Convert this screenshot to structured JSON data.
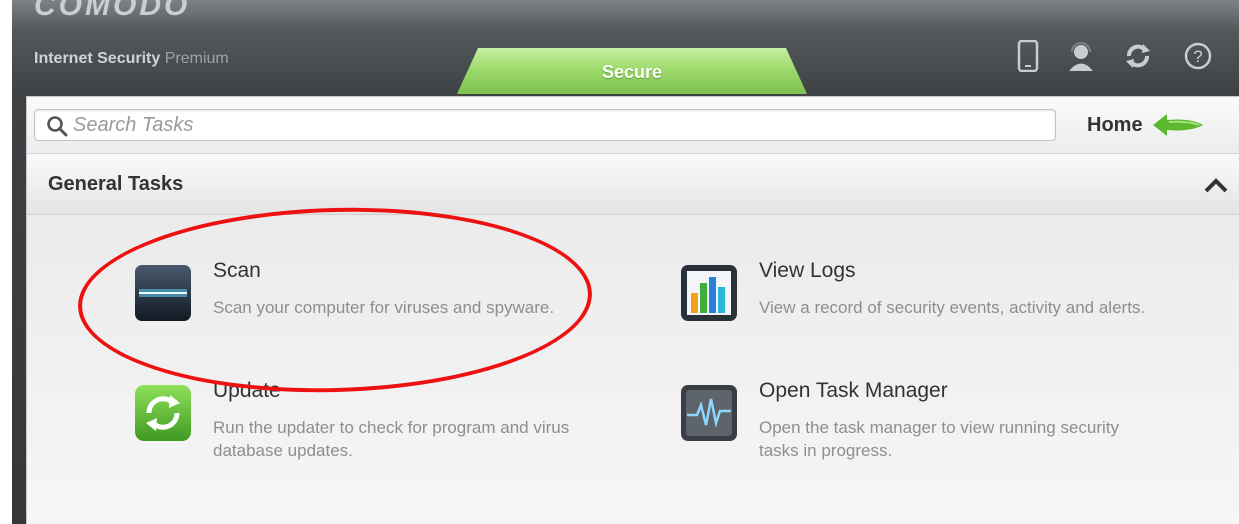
{
  "app": {
    "brand_top": "COMODO",
    "product_name_bold": "Internet Security",
    "product_name_light": "Premium"
  },
  "status": {
    "label": "Secure"
  },
  "colors": {
    "status_green": "#8ecf5e",
    "highlight_red": "#ee1111",
    "title_text": "#333333",
    "desc_text": "#8e8e8e"
  },
  "toolbar_icons": [
    "mobile-device-icon",
    "support-icon",
    "refresh-icon",
    "help-icon"
  ],
  "search": {
    "placeholder": "Search Tasks",
    "value": ""
  },
  "home": {
    "label": "Home"
  },
  "section": {
    "title": "General Tasks",
    "expanded": true
  },
  "tasks": [
    {
      "title": "Scan",
      "description": "Scan your computer for viruses and spyware.",
      "icon": "scan-icon"
    },
    {
      "title": "View Logs",
      "description": "View a record of security events, activity and alerts.",
      "icon": "view-logs-icon"
    },
    {
      "title": "Update",
      "description": "Run the updater to check for program and virus database updates.",
      "icon": "update-icon"
    },
    {
      "title": "Open Task Manager",
      "description": "Open the task manager to view running security tasks in progress.",
      "icon": "task-manager-icon"
    }
  ]
}
